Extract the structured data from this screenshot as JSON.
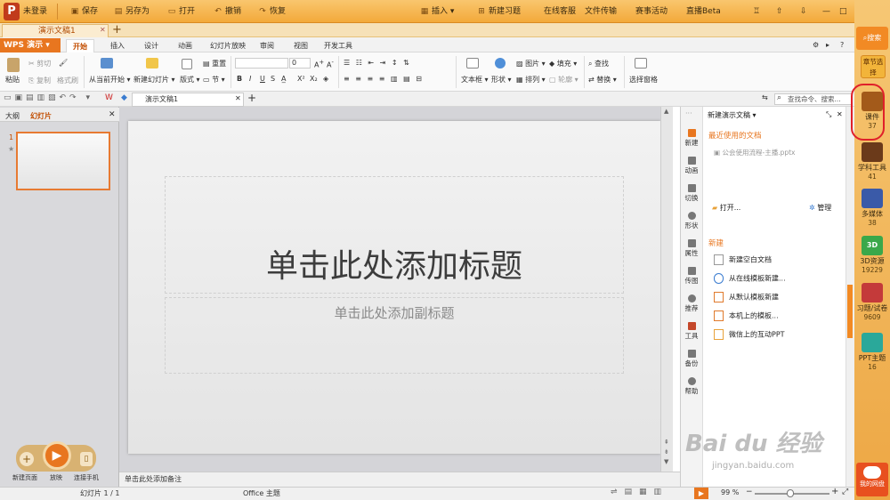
{
  "topbar": {
    "login": "未登录",
    "save": "保存",
    "save_as": "另存为",
    "open": "打开",
    "undo": "撤销",
    "redo": "恢复",
    "insert": "插入",
    "new_exercise": "新建习题",
    "online_service": "在线客服",
    "file_transfer": "文件传输",
    "contest": "赛事活动",
    "live": "直播Beta"
  },
  "doc_tab": "演示文稿1",
  "ribbon": {
    "app_button": "WPS 演示",
    "tabs": [
      "开始",
      "插入",
      "设计",
      "动画",
      "幻灯片放映",
      "审阅",
      "视图",
      "开发工具"
    ],
    "paste": "粘贴",
    "cut": "剪切",
    "copy": "复制",
    "format_painter": "格式刷",
    "from_current": "从当前开始",
    "new_slide": "新建幻灯片",
    "layout": "版式",
    "reset": "重置",
    "section": "节",
    "font_size": "0",
    "textbox": "文本框",
    "shape": "形状",
    "picture": "图片",
    "fill": "填充",
    "arrange": "排列",
    "outline": "轮廓",
    "find": "查找",
    "replace": "替换",
    "select_pane": "选择窗格"
  },
  "quick": {
    "doc_tab": "演示文稿1",
    "search_placeholder": "查找命令、搜索..."
  },
  "leftpane": {
    "outline_tab": "大纲",
    "slides_tab": "幻灯片",
    "slide_number": "1"
  },
  "slide": {
    "title": "单击此处添加标题",
    "subtitle": "单击此处添加副标题",
    "notes": "单击此处添加备注"
  },
  "play": {
    "new_page": "新建页面",
    "play": "放映",
    "connect_phone": "连接手机"
  },
  "sidebar": [
    "新建",
    "动画",
    "切换",
    "形状",
    "属性",
    "传图",
    "推荐",
    "工具",
    "备份",
    "帮助"
  ],
  "taskpane": {
    "title": "新建演示文稿",
    "recent_heading": "最近使用的文档",
    "recent_file": "公会使用流程-主播.pptx",
    "open": "打开...",
    "manage": "管理",
    "new_heading": "新建",
    "items": [
      "新建空白文档",
      "从在线模板新建...",
      "从默认模板新建",
      "本机上的模板...",
      "微信上的互动PPT"
    ]
  },
  "rightbar": {
    "search": "搜索",
    "chapter": "章节选择",
    "items": [
      {
        "label": "课件",
        "count": "37"
      },
      {
        "label": "学科工具",
        "count": "41"
      },
      {
        "label": "多媒体",
        "count": "38"
      },
      {
        "label": "3D资源",
        "count": "19229"
      },
      {
        "label": "习题/试卷",
        "count": "9609"
      },
      {
        "label": "PPT主题",
        "count": "16"
      }
    ],
    "cloud": "我的网盘"
  },
  "status": {
    "slide_counter": "幻灯片 1 / 1",
    "theme": "Office 主题",
    "zoom": "99 %"
  },
  "colors": {
    "accent": "#e8761f",
    "highlight_circle": "#e0202a"
  },
  "watermark": {
    "logo": "Bai du 经验",
    "url": "jingyan.baidu.com"
  }
}
